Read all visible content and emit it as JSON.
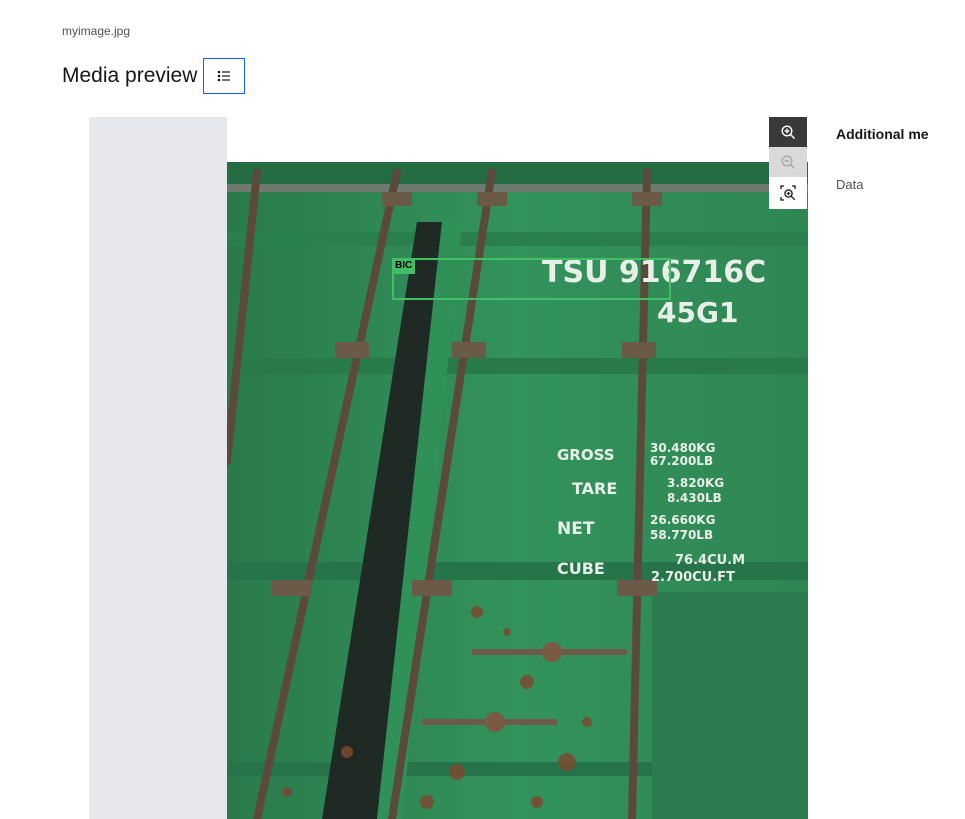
{
  "file": {
    "name": "myimage.jpg"
  },
  "header": {
    "title": "Media preview",
    "toggle_icon": "list-settings-icon"
  },
  "zoom": {
    "zoom_in_icon": "zoom-in-icon",
    "zoom_out_icon": "zoom-out-icon",
    "fit_icon": "zoom-fit-icon"
  },
  "sidebar": {
    "title": "Additional me",
    "data_label": "Data"
  },
  "annotation": {
    "label": "BIC",
    "color": "#42be65"
  },
  "photo_text": {
    "code_line1": "TSU 916716C",
    "code_line2": "45G1",
    "gross_label": "GROSS",
    "gross_kg": "30.480KG",
    "gross_lb": "67.200LB",
    "tare_label": "TARE",
    "tare_kg": "3.820KG",
    "tare_lb": "8.430LB",
    "net_label": "NET",
    "net_kg": "26.660KG",
    "net_lb": "58.770LB",
    "cube_label": "CUBE",
    "cube_m": "76.4CU.M",
    "cube_ft": "2.700CU.FT"
  },
  "colors": {
    "accent": "#0f62fe",
    "container_green": "#2e8a56",
    "toolbar_dark": "#393939"
  }
}
